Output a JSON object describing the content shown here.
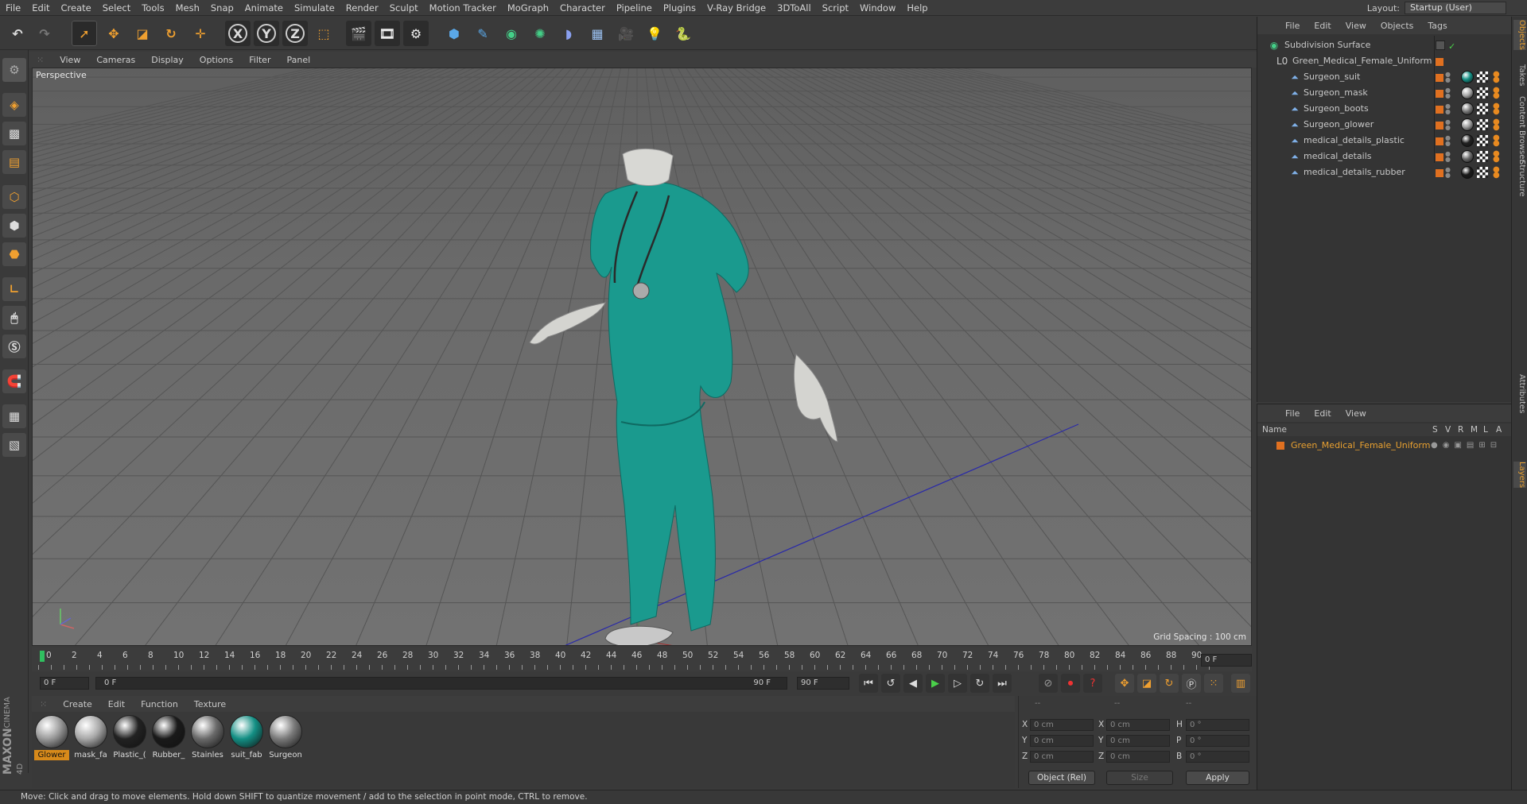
{
  "menu": [
    "File",
    "Edit",
    "Create",
    "Select",
    "Tools",
    "Mesh",
    "Snap",
    "Animate",
    "Simulate",
    "Render",
    "Sculpt",
    "Motion Tracker",
    "MoGraph",
    "Character",
    "Pipeline",
    "Plugins",
    "V-Ray Bridge",
    "3DToAll",
    "Script",
    "Window",
    "Help"
  ],
  "layout": {
    "label": "Layout:",
    "value": "Startup (User)"
  },
  "toolbar": {
    "x": "X",
    "y": "Y",
    "z": "Z"
  },
  "viewport": {
    "menu": [
      "View",
      "Cameras",
      "Display",
      "Options",
      "Filter",
      "Panel"
    ],
    "label": "Perspective",
    "grid_spacing": "Grid Spacing : 100 cm"
  },
  "timeline": {
    "ticks": [
      "0",
      "2",
      "4",
      "6",
      "8",
      "10",
      "12",
      "14",
      "16",
      "18",
      "20",
      "22",
      "24",
      "26",
      "28",
      "30",
      "32",
      "34",
      "36",
      "38",
      "40",
      "42",
      "44",
      "46",
      "48",
      "50",
      "52",
      "54",
      "56",
      "58",
      "60",
      "62",
      "64",
      "66",
      "68",
      "70",
      "72",
      "74",
      "76",
      "78",
      "80",
      "82",
      "84",
      "86",
      "88",
      "90"
    ],
    "current_frame": "0 F",
    "start": "0 F",
    "range_start": "0 F",
    "range_end": "90 F",
    "end": "90 F"
  },
  "materials": {
    "menu": [
      "Create",
      "Edit",
      "Function",
      "Texture"
    ],
    "items": [
      {
        "label": "Glower",
        "color": "#9a9a9a",
        "selected": true
      },
      {
        "label": "mask_fa",
        "color": "#a8a8a8",
        "selected": false
      },
      {
        "label": "Plastic_(",
        "color": "#222222",
        "selected": false
      },
      {
        "label": "Rubber_",
        "color": "#1a1a1a",
        "selected": false
      },
      {
        "label": "Stainles",
        "color": "#6a6a6a",
        "selected": false
      },
      {
        "label": "suit_fab",
        "color": "#138f84",
        "selected": false
      },
      {
        "label": "Surgeon",
        "color": "#7a7a7a",
        "selected": false
      }
    ]
  },
  "coords": {
    "header_a": "--",
    "header_b": "--",
    "header_c": "--",
    "rows": [
      {
        "a": "X",
        "av": "0 cm",
        "b": "X",
        "bv": "0 cm",
        "c": "H",
        "cv": "0 °"
      },
      {
        "a": "Y",
        "av": "0 cm",
        "b": "Y",
        "bv": "0 cm",
        "c": "P",
        "cv": "0 °"
      },
      {
        "a": "Z",
        "av": "0 cm",
        "b": "Z",
        "bv": "0 cm",
        "c": "B",
        "cv": "0 °"
      }
    ],
    "mode": "Object (Rel)",
    "size": "Size",
    "apply": "Apply"
  },
  "status": "Move: Click and drag to move elements. Hold down SHIFT to quantize movement / add to the selection in point mode, CTRL to remove.",
  "objects": {
    "menu": [
      "File",
      "Edit",
      "View",
      "Objects",
      "Tags"
    ],
    "root": "Subdivision Surface",
    "group": "Green_Medical_Female_Uniform",
    "items": [
      {
        "name": "Surgeon_suit",
        "mat": "#138f84"
      },
      {
        "name": "Surgeon_mask",
        "mat": "#a8a8a8"
      },
      {
        "name": "Surgeon_boots",
        "mat": "#7a7a7a"
      },
      {
        "name": "Surgeon_glower",
        "mat": "#9a9a9a"
      },
      {
        "name": "medical_details_plastic",
        "mat": "#222222"
      },
      {
        "name": "medical_details",
        "mat": "#6a6a6a"
      },
      {
        "name": "medical_details_rubber",
        "mat": "#1a1a1a"
      }
    ]
  },
  "layers": {
    "menu": [
      "File",
      "Edit",
      "View"
    ],
    "header": {
      "name": "Name",
      "s": "S",
      "v": "V",
      "r": "R",
      "m": "M",
      "l": "L",
      "a": "A"
    },
    "item": "Green_Medical_Female_Uniform"
  },
  "side_tabs": [
    "Objects",
    "Takes",
    "Content Browser",
    "Structure",
    "Attributes",
    "Layers"
  ],
  "brand": {
    "maxon": "MAXON",
    "product": "CINEMA 4D"
  },
  "colors": {
    "accent": "#e8a030",
    "suit": "#138f84",
    "layer": "#e07020"
  }
}
